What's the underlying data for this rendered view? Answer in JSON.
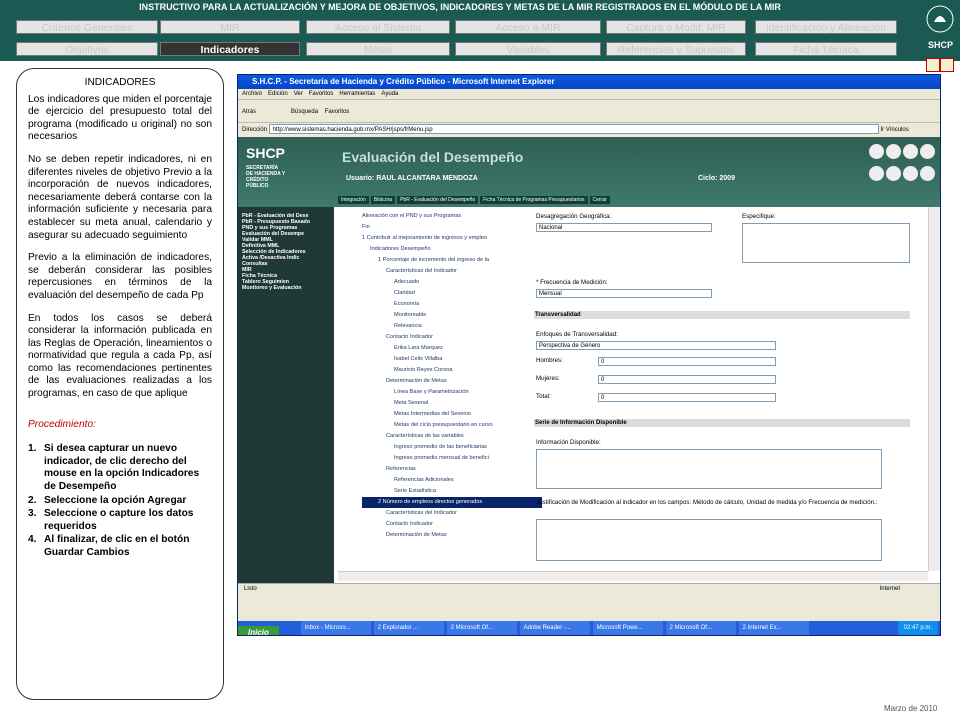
{
  "title": "INSTRUCTIVO PARA LA ACTUALIZACIÓN Y MEJORA DE OBJETIVOS, INDICADORES Y METAS DE LA MIR REGISTRADOS EN EL MÓDULO DE LA MIR",
  "nav_row1": [
    "Criterios Generales",
    "MIR",
    "Acceso al Sistema",
    "Acceso a MIR",
    "Captura o Modif. MIR",
    "Identificación y Alineación"
  ],
  "nav_row2": [
    "Objetivos",
    "Indicadores",
    "Metas",
    "Variables",
    "Referencias y Supuestos",
    "Ficha Técnica"
  ],
  "shcp_label": "SHCP",
  "panel": {
    "title": "INDICADORES",
    "p1": "Los indicadores que miden el porcentaje de ejercicio del presupuesto total del programa (modificado u original) no son necesarios",
    "p2": "No se deben repetir indicadores, ni en diferentes niveles de objetivo Previo a la incorporación de nuevos indicadores, necesariamente deberá contarse con la información suficiente y necesaria para establecer su meta anual, calendario y asegurar su adecuado seguimiento",
    "p3": "Previo a la eliminación de indicadores, se deberán considerar las posibles repercusiones en términos de la evaluación del desempeño de cada Pp",
    "p4": "En todos los casos se deberá considerar la información publicada en las Reglas de Operación, lineamientos o normatividad que regula a cada Pp, así como las recomendaciones pertinentes de las evaluaciones realizadas a los programas, en caso de que aplique",
    "proc_title": "Procedimiento:",
    "steps": [
      {
        "n": "1.",
        "t": "Si desea capturar un nuevo indicador, de clic derecho del mouse en la opción Indicadores de Desempeño"
      },
      {
        "n": "2.",
        "t": "Seleccione la opción Agregar"
      },
      {
        "n": "3.",
        "t": "Seleccione o capture los datos requeridos"
      },
      {
        "n": "4.",
        "t": "Al finalizar, de clic en el botón Guardar Cambios"
      }
    ]
  },
  "date": "Marzo de 2010",
  "ie": {
    "title": "S.H.C.P. - Secretaría de Hacienda y Crédito Público - Microsoft Internet Explorer",
    "menu": [
      "Archivo",
      "Edición",
      "Ver",
      "Favoritos",
      "Herramientas",
      "Ayuda"
    ],
    "back": "Atrás",
    "search": "Búsqueda",
    "favorites": "Favoritos",
    "address_label": "Dirección",
    "url": "http://www.sistemas.hacienda.gob.mx/PASH/jsps/frMenu.jsp",
    "go": "Ir",
    "links": "Vínculos",
    "status": "Listo",
    "zone": "Internet"
  },
  "app": {
    "shcp": "SHCP",
    "desc": "SECRETARÍA DE HACIENDA Y CRÉDITO PÚBLICO",
    "eval": "Evaluación del Desempeño",
    "user": "Usuario: RAUL ALCANTARA MENDOZA",
    "cycle": "Ciclo: 2009",
    "tabs": [
      "Integración",
      "Bitácora",
      "PbR - Evaluación del Desempeño",
      "Ficha Técnica de Programas Presupuestarios",
      "Cerrar"
    ]
  },
  "side": [
    "PbR - Evaluación del Dese",
    "PbR - Presupuesto Basado",
    "PND y sus Programas",
    "Evaluación del Desempe",
    "Validar MML",
    "Definitiva MML",
    "Selección de Indicadores",
    "Activa /Desactiva Indic",
    "Consultas",
    "MIR",
    "Ficha Técnica",
    "Tablero Seguimien",
    "Monitoreo y Evaluación"
  ],
  "tree": [
    "Alineación con el PND y sus Programas",
    "Fin",
    "1 Contribuir al mejoramiento de ingresos y empleo",
    "Indicadores Desempeño",
    "1 Porcentaje de incremento del ingreso de la",
    "Características del Indicador",
    "Adecuado",
    "Claridad",
    "Economía",
    "Monitoreable",
    "Relevancia",
    "Contacto Indicador",
    "Erika Lara Marquez",
    "Isabel Celis Villalba",
    "Mauricio Reyes Corona",
    "Determinación de Metas",
    "Línea Base y Parametrización",
    "Meta Sexenal",
    "Metas Intermedias del Sexenio",
    "Metas del ciclo presupuestario en curso",
    "Características de las variables",
    "Ingreso promedio de las beneficiarias",
    "Ingreso promedio mensual de benefici",
    "Referencias",
    "Referencias Adicionales",
    "Serie Estadística",
    "2 Número de empleos directos generados",
    "Características del Indicador",
    "Contacto Indicador",
    "Determinación de Metas"
  ],
  "form": {
    "desag_label": "Desagregación Geográfica:",
    "desag_value": "Nacional",
    "esp_label": "Especifique:",
    "freq_label": "* Frecuencia de Medición:",
    "freq_value": "Mensual",
    "transv": "Transversalidad",
    "enfoques_label": "Enfoques de Transversalidad:",
    "enfoques_value": "Perspectiva de Género",
    "hombres_label": "Hombres:",
    "hombres": "0",
    "mujeres_label": "Mujeres:",
    "mujeres": "0",
    "total_label": "Total:",
    "total": "0",
    "serie": "Serie de Información Disponible",
    "info_label": "Información Disponible:",
    "just_label": "Justificación de Modificación al indicador en los campos: Método de cálculo, Unidad de medida y/o Frecuencia de medición.:"
  },
  "taskbar": {
    "start": "Inicio",
    "tasks": [
      "Inbox - Microso...",
      "2 Explorador ...",
      "2 Microsoft Of...",
      "Adobe Reader -...",
      "Microsoft Powe...",
      "2 Microsoft Of...",
      "2 Internet Ex..."
    ],
    "clock": "02:47 p.m."
  }
}
